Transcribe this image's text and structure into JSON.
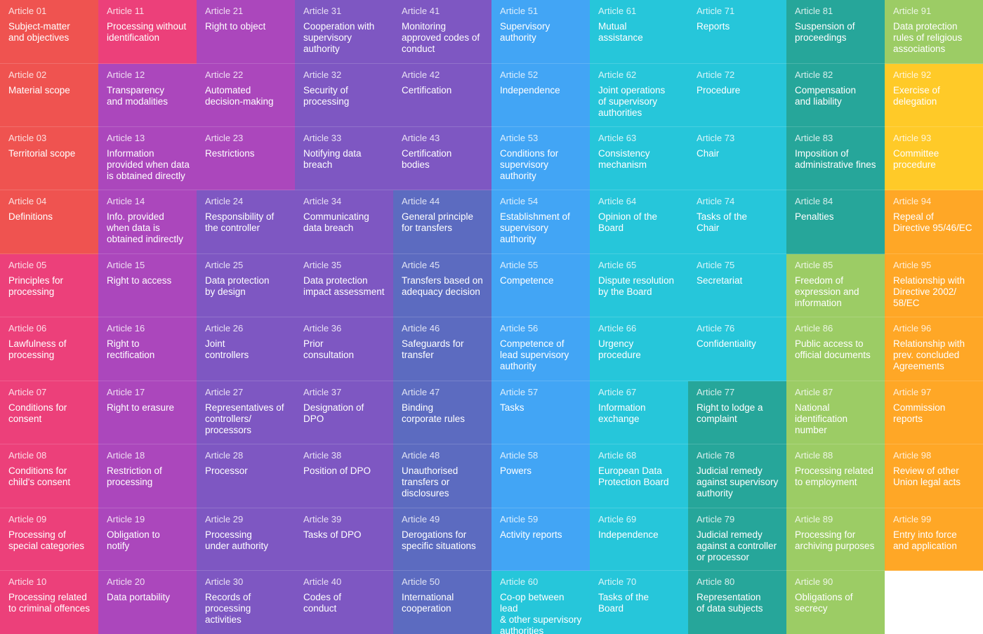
{
  "palette": {
    "red": "#EF5350",
    "pink": "#EC407A",
    "purple": "#AB47BC",
    "deep_purple": "#7E57C2",
    "indigo": "#5C6BC0",
    "blue": "#42A5F5",
    "cyan": "#26C6DA",
    "teal": "#26A69A",
    "light_green": "#9CCC65",
    "amber": "#FFCA28",
    "orange": "#FFA726"
  },
  "articles": [
    {
      "label": "Article 01",
      "title": "Subject-matter\nand objectives",
      "color": "red"
    },
    {
      "label": "Article 02",
      "title": "Material scope",
      "color": "red"
    },
    {
      "label": "Article 03",
      "title": "Territorial scope",
      "color": "red"
    },
    {
      "label": "Article 04",
      "title": "Definitions",
      "color": "red"
    },
    {
      "label": "Article 05",
      "title": "Principles for\nprocessing",
      "color": "pink"
    },
    {
      "label": "Article 06",
      "title": "Lawfulness of\nprocessing",
      "color": "pink"
    },
    {
      "label": "Article 07",
      "title": "Conditions for\nconsent",
      "color": "pink"
    },
    {
      "label": "Article 08",
      "title": "Conditions for\nchild's consent",
      "color": "pink"
    },
    {
      "label": "Article 09",
      "title": "Processing of\nspecial categories",
      "color": "pink"
    },
    {
      "label": "Article 10",
      "title": "Processing related\nto criminal offences",
      "color": "pink"
    },
    {
      "label": "Article 11",
      "title": "Processing without\nidentification",
      "color": "pink"
    },
    {
      "label": "Article 12",
      "title": "Transparency\nand modalities",
      "color": "purple"
    },
    {
      "label": "Article 13",
      "title": "Information\nprovided when data\nis obtained directly",
      "color": "purple"
    },
    {
      "label": "Article 14",
      "title": "Info. provided\nwhen data is\nobtained indirectly",
      "color": "purple"
    },
    {
      "label": "Article 15",
      "title": "Right to access",
      "color": "purple"
    },
    {
      "label": "Article 16",
      "title": "Right to\nrectification",
      "color": "purple"
    },
    {
      "label": "Article 17",
      "title": "Right to erasure",
      "color": "purple"
    },
    {
      "label": "Article 18",
      "title": "Restriction of\nprocessing",
      "color": "purple"
    },
    {
      "label": "Article 19",
      "title": "Obligation to\nnotify",
      "color": "purple"
    },
    {
      "label": "Article 20",
      "title": "Data portability",
      "color": "purple"
    },
    {
      "label": "Article 21",
      "title": "Right to object",
      "color": "purple"
    },
    {
      "label": "Article 22",
      "title": "Automated\ndecision-making",
      "color": "purple"
    },
    {
      "label": "Article 23",
      "title": "Restrictions",
      "color": "purple"
    },
    {
      "label": "Article 24",
      "title": "Responsibility of\nthe controller",
      "color": "deep_purple"
    },
    {
      "label": "Article 25",
      "title": "Data protection\nby design",
      "color": "deep_purple"
    },
    {
      "label": "Article 26",
      "title": "Joint\ncontrollers",
      "color": "deep_purple"
    },
    {
      "label": "Article 27",
      "title": "Representatives of\ncontrollers/\nprocessors",
      "color": "deep_purple"
    },
    {
      "label": "Article 28",
      "title": "Processor",
      "color": "deep_purple"
    },
    {
      "label": "Article 29",
      "title": "Processing\nunder authority",
      "color": "deep_purple"
    },
    {
      "label": "Article 30",
      "title": "Records of\nprocessing\nactivities",
      "color": "deep_purple"
    },
    {
      "label": "Article 31",
      "title": "Cooperation with\nsupervisory\nauthority",
      "color": "deep_purple"
    },
    {
      "label": "Article 32",
      "title": "Security of\nprocessing",
      "color": "deep_purple"
    },
    {
      "label": "Article 33",
      "title": "Notifying data\nbreach",
      "color": "deep_purple"
    },
    {
      "label": "Article 34",
      "title": "Communicating\ndata breach",
      "color": "deep_purple"
    },
    {
      "label": "Article 35",
      "title": "Data protection\nimpact assessment",
      "color": "deep_purple"
    },
    {
      "label": "Article 36",
      "title": "Prior\nconsultation",
      "color": "deep_purple"
    },
    {
      "label": "Article 37",
      "title": "Designation of\nDPO",
      "color": "deep_purple"
    },
    {
      "label": "Article 38",
      "title": "Position of DPO",
      "color": "deep_purple"
    },
    {
      "label": "Article 39",
      "title": "Tasks of DPO",
      "color": "deep_purple"
    },
    {
      "label": "Article 40",
      "title": "Codes of\nconduct",
      "color": "deep_purple"
    },
    {
      "label": "Article 41",
      "title": "Monitoring\napproved codes of\nconduct",
      "color": "deep_purple"
    },
    {
      "label": "Article 42",
      "title": "Certification",
      "color": "deep_purple"
    },
    {
      "label": "Article 43",
      "title": "Certification\nbodies",
      "color": "deep_purple"
    },
    {
      "label": "Article 44",
      "title": "General principle\nfor transfers",
      "color": "indigo"
    },
    {
      "label": "Article 45",
      "title": "Transfers based on\nadequacy decision",
      "color": "indigo"
    },
    {
      "label": "Article 46",
      "title": "Safeguards for\ntransfer",
      "color": "indigo"
    },
    {
      "label": "Article 47",
      "title": "Binding\ncorporate rules",
      "color": "indigo"
    },
    {
      "label": "Article 48",
      "title": "Unauthorised\ntransfers or\ndisclosures",
      "color": "indigo"
    },
    {
      "label": "Article 49",
      "title": "Derogations for\nspecific situations",
      "color": "indigo"
    },
    {
      "label": "Article 50",
      "title": "International\ncooperation",
      "color": "indigo"
    },
    {
      "label": "Article 51",
      "title": "Supervisory\nauthority",
      "color": "blue"
    },
    {
      "label": "Article 52",
      "title": "Independence",
      "color": "blue"
    },
    {
      "label": "Article 53",
      "title": "Conditions for\nsupervisory\nauthority",
      "color": "blue"
    },
    {
      "label": "Article 54",
      "title": "Establishment of\nsupervisory\nauthority",
      "color": "blue"
    },
    {
      "label": "Article 55",
      "title": "Competence",
      "color": "blue"
    },
    {
      "label": "Article 56",
      "title": "Competence of\nlead supervisory\nauthority",
      "color": "blue"
    },
    {
      "label": "Article 57",
      "title": "Tasks",
      "color": "blue"
    },
    {
      "label": "Article 58",
      "title": "Powers",
      "color": "blue"
    },
    {
      "label": "Article 59",
      "title": "Activity reports",
      "color": "blue"
    },
    {
      "label": "Article 60",
      "title": "Co-op between lead\n& other supervisory\nauthorities",
      "color": "cyan"
    },
    {
      "label": "Article 61",
      "title": "Mutual\nassistance",
      "color": "cyan"
    },
    {
      "label": "Article 62",
      "title": "Joint operations\nof supervisory\nauthorities",
      "color": "cyan"
    },
    {
      "label": "Article 63",
      "title": "Consistency\nmechanism",
      "color": "cyan"
    },
    {
      "label": "Article 64",
      "title": "Opinion of the\nBoard",
      "color": "cyan"
    },
    {
      "label": "Article 65",
      "title": "Dispute resolution\nby the Board",
      "color": "cyan"
    },
    {
      "label": "Article 66",
      "title": "Urgency\nprocedure",
      "color": "cyan"
    },
    {
      "label": "Article 67",
      "title": "Information\nexchange",
      "color": "cyan"
    },
    {
      "label": "Article 68",
      "title": "European Data\nProtection Board",
      "color": "cyan"
    },
    {
      "label": "Article 69",
      "title": "Independence",
      "color": "cyan"
    },
    {
      "label": "Article 70",
      "title": "Tasks of the\nBoard",
      "color": "cyan"
    },
    {
      "label": "Article 71",
      "title": "Reports",
      "color": "cyan"
    },
    {
      "label": "Article 72",
      "title": "Procedure",
      "color": "cyan"
    },
    {
      "label": "Article 73",
      "title": "Chair",
      "color": "cyan"
    },
    {
      "label": "Article 74",
      "title": "Tasks of the\nChair",
      "color": "cyan"
    },
    {
      "label": "Article 75",
      "title": "Secretariat",
      "color": "cyan"
    },
    {
      "label": "Article 76",
      "title": "Confidentiality",
      "color": "cyan"
    },
    {
      "label": "Article 77",
      "title": "Right to lodge a\ncomplaint",
      "color": "teal"
    },
    {
      "label": "Article 78",
      "title": "Judicial remedy\nagainst supervisory\nauthority",
      "color": "teal"
    },
    {
      "label": "Article 79",
      "title": "Judicial remedy\nagainst a controller\nor processor",
      "color": "teal"
    },
    {
      "label": "Article 80",
      "title": "Representation\nof data subjects",
      "color": "teal"
    },
    {
      "label": "Article 81",
      "title": "Suspension of\nproceedings",
      "color": "teal"
    },
    {
      "label": "Article 82",
      "title": "Compensation\nand liability",
      "color": "teal"
    },
    {
      "label": "Article 83",
      "title": "Imposition of\nadministrative fines",
      "color": "teal"
    },
    {
      "label": "Article 84",
      "title": "Penalties",
      "color": "teal"
    },
    {
      "label": "Article 85",
      "title": "Freedom of\nexpression and\ninformation",
      "color": "light_green"
    },
    {
      "label": "Article 86",
      "title": "Public access to\nofficial documents",
      "color": "light_green"
    },
    {
      "label": "Article 87",
      "title": "National\nidentification\nnumber",
      "color": "light_green"
    },
    {
      "label": "Article 88",
      "title": "Processing related\nto employment",
      "color": "light_green"
    },
    {
      "label": "Article 89",
      "title": "Processing for\narchiving purposes",
      "color": "light_green"
    },
    {
      "label": "Article 90",
      "title": "Obligations of\nsecrecy",
      "color": "light_green"
    },
    {
      "label": "Article 91",
      "title": "Data protection\nrules of religious\nassociations",
      "color": "light_green"
    },
    {
      "label": "Article 92",
      "title": "Exercise of\ndelegation",
      "color": "amber"
    },
    {
      "label": "Article 93",
      "title": "Committee\nprocedure",
      "color": "amber"
    },
    {
      "label": "Article 94",
      "title": "Repeal of\nDirective 95/46/EC",
      "color": "orange"
    },
    {
      "label": "Article 95",
      "title": "Relationship with\nDirective 2002/\n58/EC",
      "color": "orange"
    },
    {
      "label": "Article 96",
      "title": "Relationship with\nprev. concluded\nAgreements",
      "color": "orange"
    },
    {
      "label": "Article 97",
      "title": "Commission\nreports",
      "color": "orange"
    },
    {
      "label": "Article 98",
      "title": "Review of other\nUnion legal acts",
      "color": "orange"
    },
    {
      "label": "Article 99",
      "title": "Entry into force\nand application",
      "color": "orange"
    }
  ]
}
